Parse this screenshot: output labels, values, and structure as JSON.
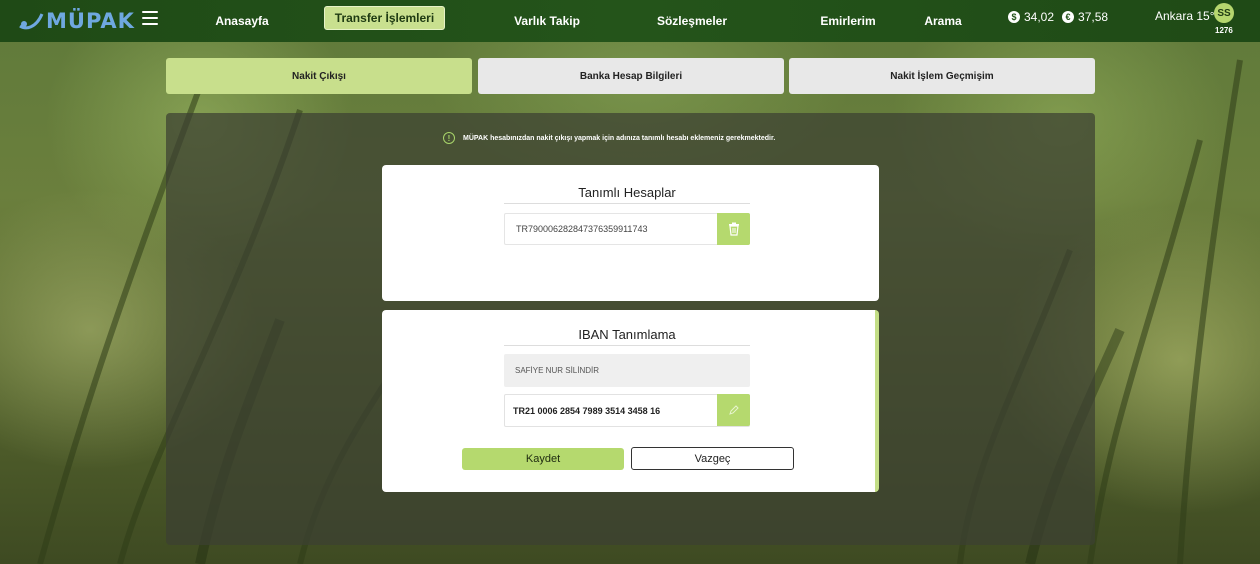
{
  "app": {
    "logo_text": "MÜPAK"
  },
  "nav": {
    "items": [
      {
        "label": "Anasayfa"
      },
      {
        "label": "Transfer İşlemleri"
      },
      {
        "label": "Varlık Takip"
      },
      {
        "label": "Sözleşmeler"
      },
      {
        "label": "Emirlerim"
      },
      {
        "label": "Arama"
      }
    ],
    "active": "Transfer İşlemleri"
  },
  "rates": {
    "usd": {
      "icon": "dollar-icon",
      "value": "34,02"
    },
    "eur": {
      "icon": "euro-icon",
      "value": "37,58"
    }
  },
  "weather": "Ankara 15°",
  "user": {
    "initials": "SS",
    "number": "1276"
  },
  "subtabs": [
    {
      "label": "Nakit Çıkışı"
    },
    {
      "label": "Banka Hesap Bilgileri"
    },
    {
      "label": "Nakit İşlem Geçmişim"
    }
  ],
  "notice": "MÜPAK hesabınızdan nakit çıkışı yapmak için adınıza tanımlı hesabı eklemeniz gerekmektedir.",
  "defined_accounts": {
    "title": "Tanımlı Hesaplar",
    "accounts": [
      "TR790006282847376359911743"
    ],
    "delete_icon": "trash-icon"
  },
  "iban_form": {
    "title": "IBAN Tanımlama",
    "name_value": "SAFİYE NUR SİLİNDİR",
    "iban_value": "TR21 0006 2854 7989 3514 3458 16",
    "edit_icon": "pencil-icon",
    "save_label": "Kaydet",
    "cancel_label": "Vazgeç"
  },
  "colors": {
    "accent": "#b5d96e",
    "topbar": "#24541a",
    "active_tab": "#c8df8c"
  }
}
